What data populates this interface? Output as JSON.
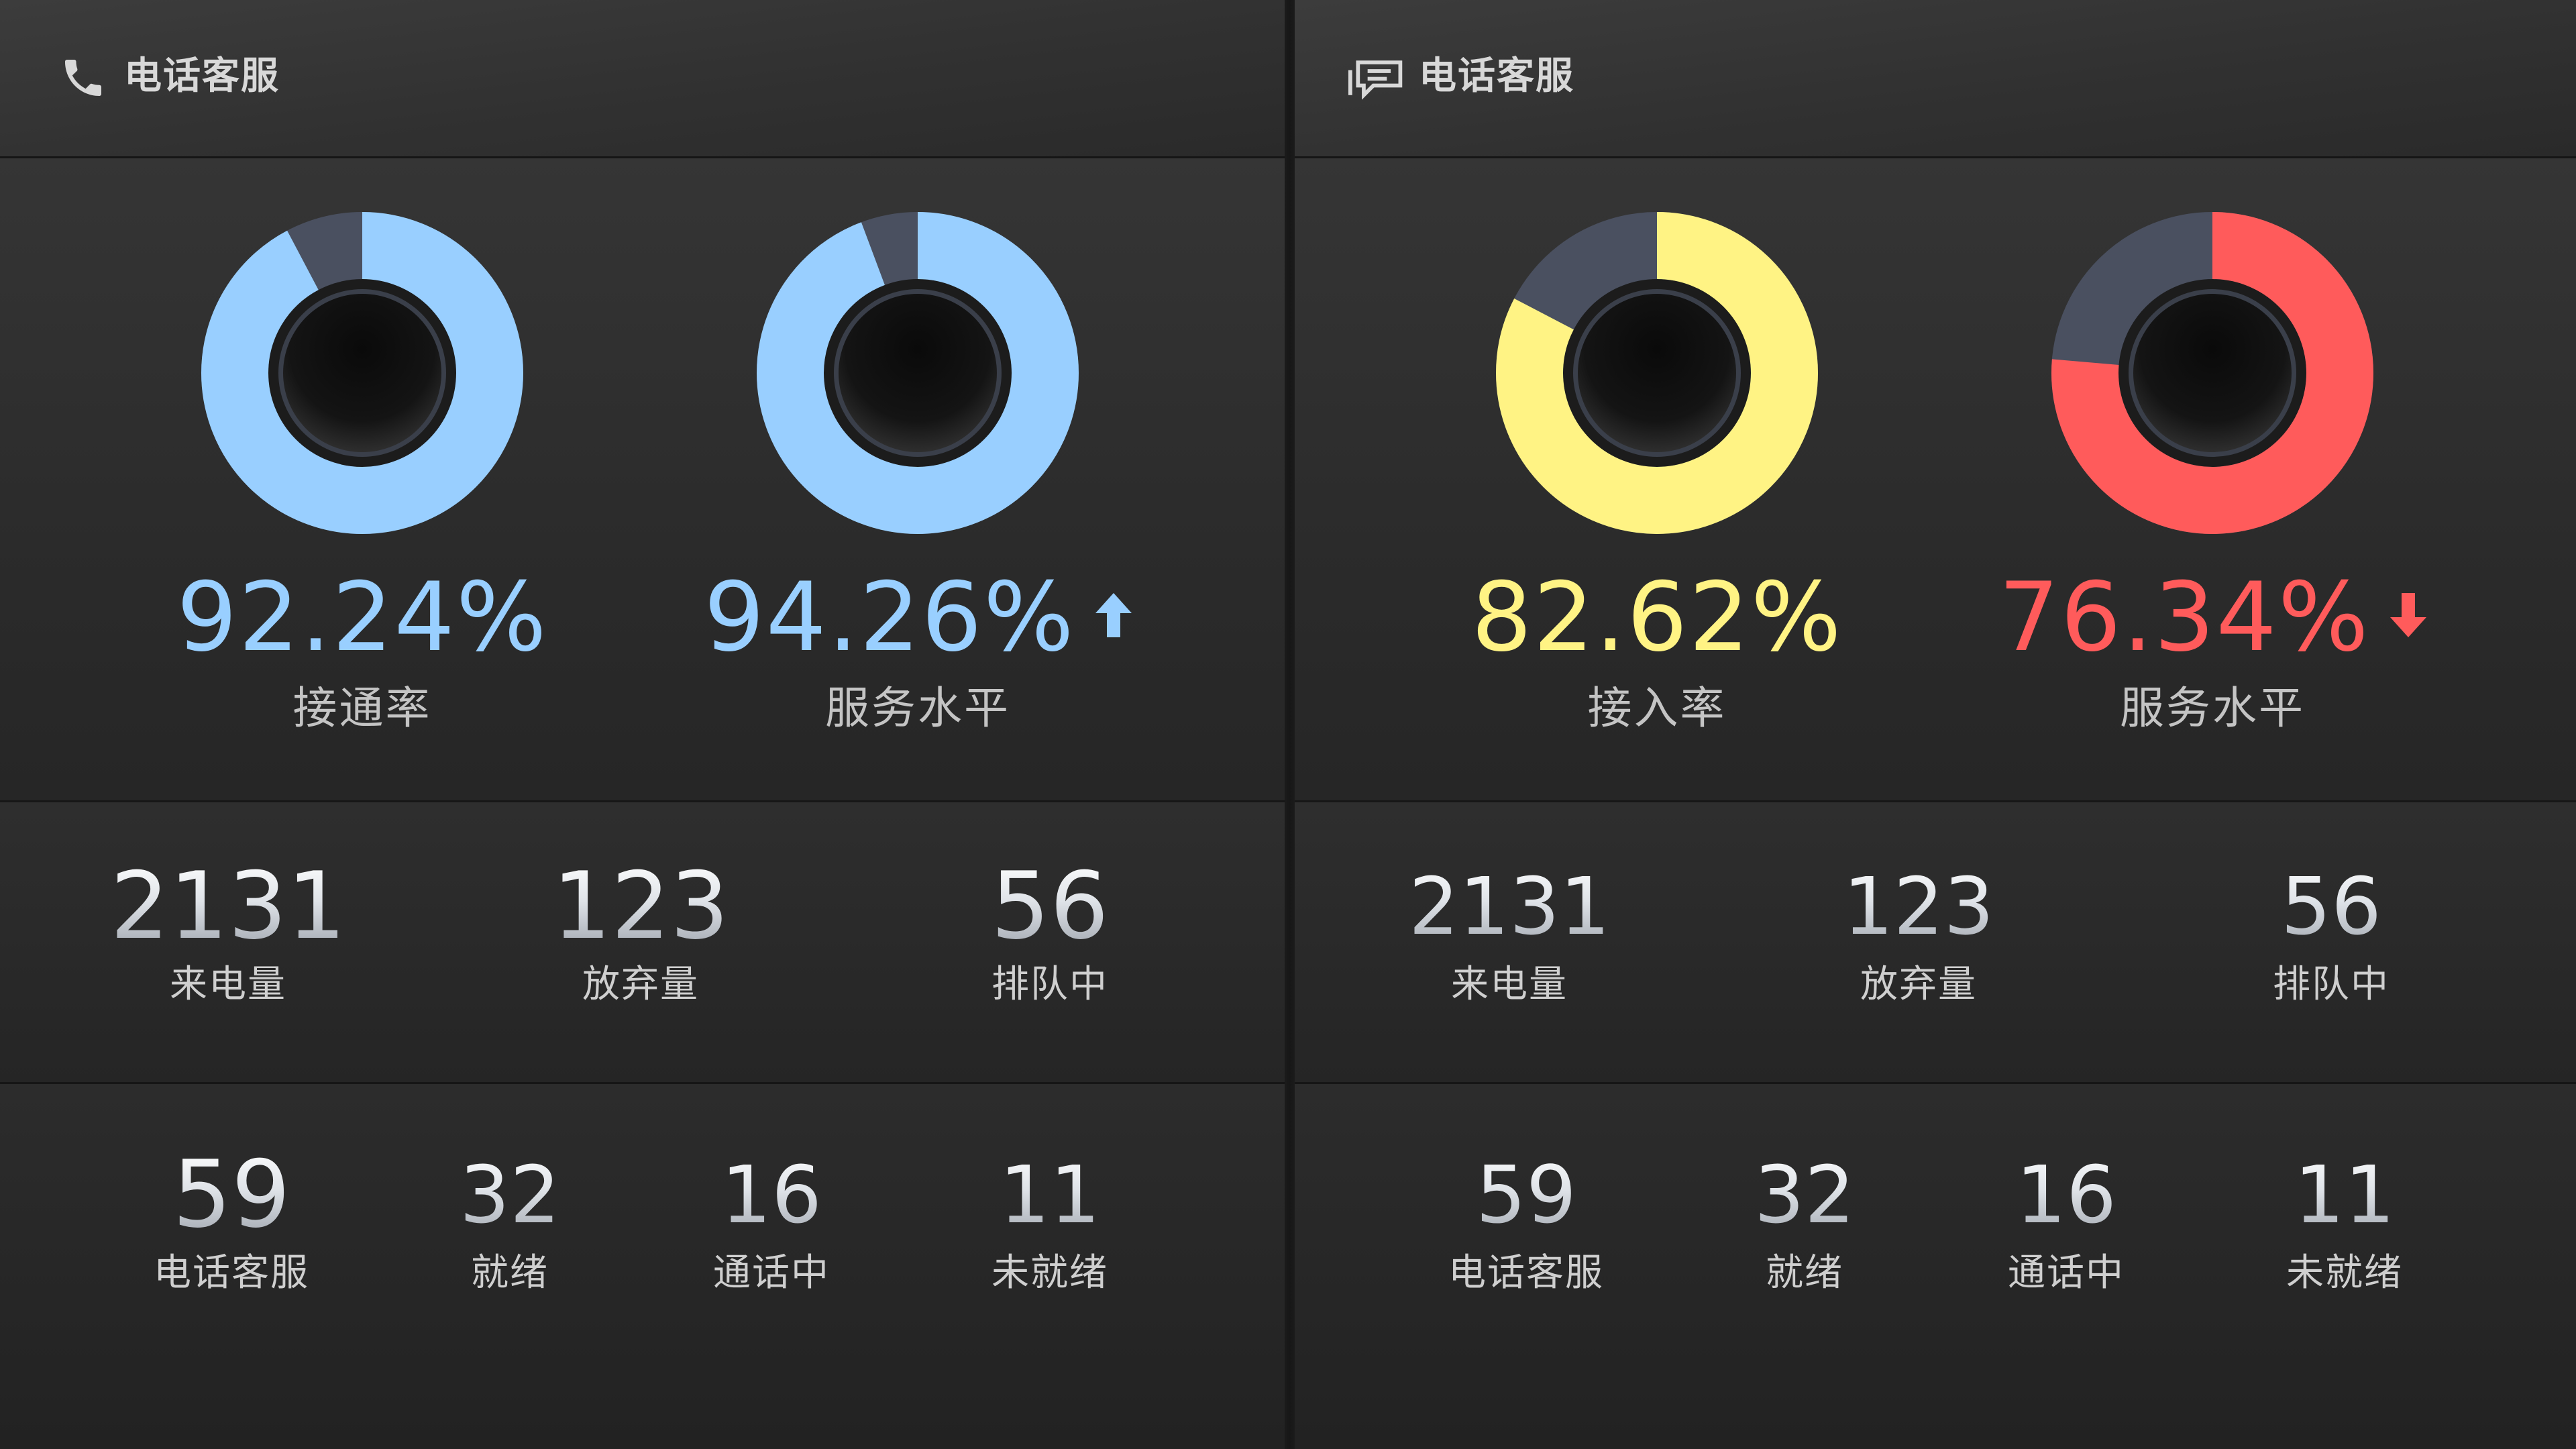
{
  "colors": {
    "blue": "#99cfff",
    "yellow": "#fff384",
    "red": "#ff5b5b",
    "track": "#4a5060",
    "up_arrow": "#99cfff",
    "down_arrow": "#ff5b5b"
  },
  "panels": [
    {
      "title": "电话客服",
      "icon": "phone-icon",
      "gauges": [
        {
          "value": "92.24%",
          "fraction": 0.9224,
          "label": "接通率",
          "color": "#99cfff",
          "trend": null
        },
        {
          "value": "94.26%",
          "fraction": 0.9426,
          "label": "服务水平",
          "color": "#99cfff",
          "trend": "up"
        }
      ],
      "stats": [
        {
          "value": "2131",
          "label": "来电量"
        },
        {
          "value": "123",
          "label": "放弃量"
        },
        {
          "value": "56",
          "label": "排队中"
        }
      ],
      "agents": [
        {
          "value": "59",
          "label": "电话客服"
        },
        {
          "value": "32",
          "label": "就绪"
        },
        {
          "value": "16",
          "label": "通话中"
        },
        {
          "value": "11",
          "label": "未就绪"
        }
      ]
    },
    {
      "title": "电话客服",
      "icon": "chat-icon",
      "gauges": [
        {
          "value": "82.62%",
          "fraction": 0.8262,
          "label": "接入率",
          "color": "#fff384",
          "trend": null
        },
        {
          "value": "76.34%",
          "fraction": 0.7634,
          "label": "服务水平",
          "color": "#ff5b5b",
          "trend": "down"
        }
      ],
      "stats": [
        {
          "value": "2131",
          "label": "来电量"
        },
        {
          "value": "123",
          "label": "放弃量"
        },
        {
          "value": "56",
          "label": "排队中"
        }
      ],
      "agents": [
        {
          "value": "59",
          "label": "电话客服"
        },
        {
          "value": "32",
          "label": "就绪"
        },
        {
          "value": "16",
          "label": "通话中"
        },
        {
          "value": "11",
          "label": "未就绪"
        }
      ]
    }
  ]
}
